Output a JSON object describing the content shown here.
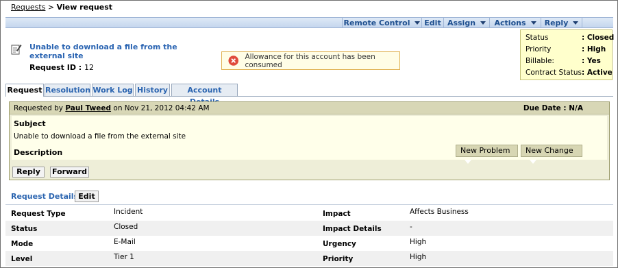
{
  "breadcrumb": {
    "link": "Requests",
    "separator": ">",
    "current": "View request"
  },
  "toolbar": {
    "remote_control": "Remote Control",
    "edit": "Edit",
    "assign": "Assign",
    "actions": "Actions",
    "reply": "Reply"
  },
  "request": {
    "title": "Unable to download a file from the external site",
    "id_label": "Request ID :",
    "id_value": "12"
  },
  "alert": {
    "text": "Allowance for this account has been consumed"
  },
  "status_box": [
    {
      "label": "Status",
      "value": ": Closed"
    },
    {
      "label": "Priority",
      "value": ": High"
    },
    {
      "label": "Billable:",
      "value": ": Yes"
    },
    {
      "label": "Contract Status:",
      "value": ": Active"
    }
  ],
  "tabs": [
    "Request",
    "Resolution",
    "Work Log",
    "History",
    "Account Details"
  ],
  "panel": {
    "requested_by_prefix": "Requested by",
    "requester": "Paul Tweed",
    "requested_on": "on Nov 21, 2012 04:42 AM",
    "due_date": "Due Date : N/A",
    "subject_label": "Subject",
    "subject_text": "Unable to download a file from the external site",
    "description_label": "Description",
    "new_problem": "New Problem",
    "new_change": "New Change",
    "reply": "Reply",
    "forward": "Forward"
  },
  "details": {
    "title": "Request Details",
    "edit": "Edit",
    "rows": [
      {
        "l1": "Request Type",
        "v1": "Incident",
        "l2": "Impact",
        "v2": "Affects Business"
      },
      {
        "l1": "Status",
        "v1": "Closed",
        "l2": "Impact Details",
        "v2": "-"
      },
      {
        "l1": "Mode",
        "v1": "E-Mail",
        "l2": "Urgency",
        "v2": "High"
      },
      {
        "l1": "Level",
        "v1": "Tier 1",
        "l2": "Priority",
        "v2": "High"
      }
    ]
  },
  "colors": {
    "link_blue": "#2c65b0",
    "panel_bg": "#eeeed8",
    "status_bg": "#ffffcc",
    "alert_red": "#e04b3c"
  },
  "icons": {
    "request": "edit-note-icon",
    "alert": "error-x-icon",
    "dropdown": "triangle-down-icon"
  }
}
